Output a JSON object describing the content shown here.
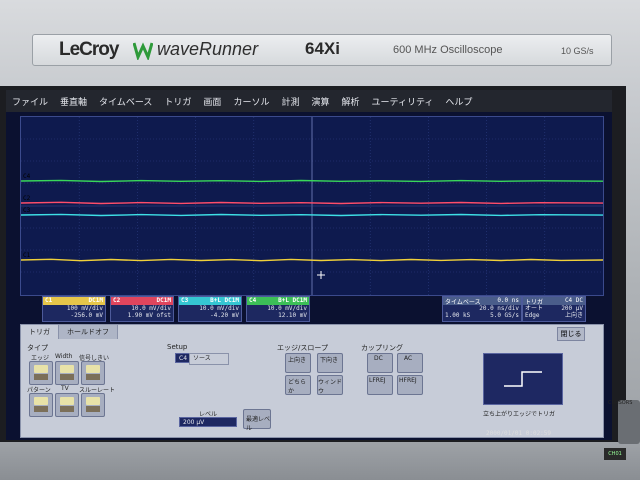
{
  "brand": {
    "maker": "LeCroy",
    "series": "waveRunner",
    "model": "64Xi",
    "description": "600 MHz Oscilloscope",
    "sample_rate": "10 GS/s",
    "colors": {
      "bezel": "#c9ccd0",
      "screen": "#0b1130"
    }
  },
  "menu": [
    "ファイル",
    "垂直軸",
    "タイムベース",
    "トリガ",
    "画面",
    "カーソル",
    "計測",
    "演算",
    "解析",
    "ユーティリティ",
    "ヘルプ"
  ],
  "traces": [
    {
      "label": "C4",
      "color": "#39d75a"
    },
    {
      "label": "C2",
      "color": "#ff4d6a"
    },
    {
      "label": "C3",
      "color": "#3ee0e6"
    },
    {
      "label": "C1",
      "color": "#f0d03a"
    }
  ],
  "channels": [
    {
      "name": "C1",
      "color": "#e6c64a",
      "coupling": "DC1M",
      "line1": "100 mV/div",
      "line2": "-256.0 mV"
    },
    {
      "name": "C2",
      "color": "#e0455d",
      "coupling": "DC1M",
      "line1": "10.0 mV/div",
      "line2": "1.90 mV ofst"
    },
    {
      "name": "C3",
      "color": "#35c6d2",
      "coupling": "B+L DC1M",
      "line1": "10.0 mV/div",
      "line2": "-4.20 mV"
    },
    {
      "name": "C4",
      "color": "#3cbf57",
      "coupling": "B+L DC1M",
      "line1": "10.0 mV/div",
      "line2": "12.10 mV"
    }
  ],
  "timebase": {
    "label": "タイムベース",
    "delay": "0.0 ns",
    "per_div": "20.0 ns/div",
    "samples": "1.00 kS",
    "rate": "5.0 GS/s"
  },
  "trigger": {
    "label": "トリガ",
    "channel": "C4 DC",
    "mode": "オート",
    "level": "200 μV",
    "type": "Edge",
    "slope": "上向き"
  },
  "dialog": {
    "tabs": [
      "トリガ",
      "ホールドオフ"
    ],
    "close": "閉じる",
    "type_label": "タイプ",
    "type_buttons": [
      "エッジ",
      "Width",
      "信号しきい",
      "パターン",
      "TV",
      "スルーレート"
    ],
    "setup_label": "Setup",
    "source_channel": "C4",
    "source_label": "ソース",
    "level_label": "レベル",
    "level_value": "200 μV",
    "find_level": "最適レベル",
    "slope_label": "エッジ/スロープ",
    "slope_buttons": [
      "上向き",
      "下向き",
      "どちらか",
      "ウィンドウ"
    ],
    "coupling_label": "カップリング",
    "coupling_buttons": [
      "DC",
      "AC",
      "LFREJ",
      "HFREJ"
    ],
    "preview_caption": "立ち上がりエッジでトリガ"
  },
  "status": {
    "datetime": "2000/01/01 0:02:59"
  },
  "panel": {
    "knob_label": "CURSORS",
    "led_label": "CH01"
  }
}
